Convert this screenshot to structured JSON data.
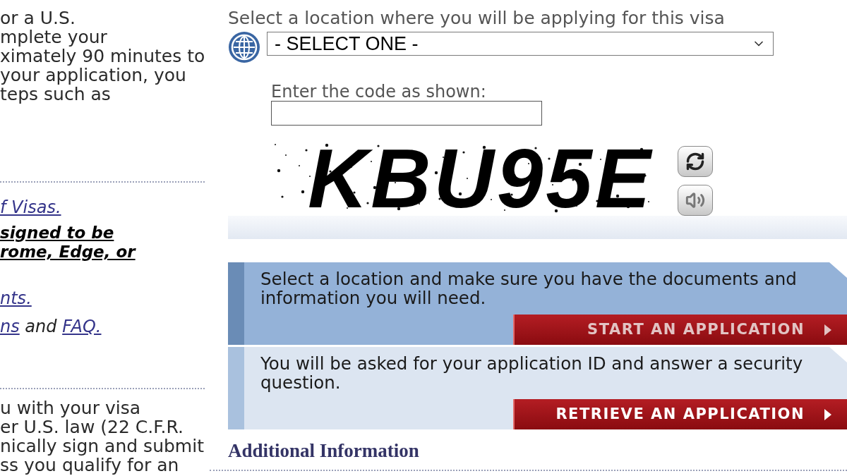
{
  "intro": {
    "lines": [
      "or a U.S.",
      "mplete your",
      "ximately 90 minutes to",
      "your application, you",
      "teps such as"
    ]
  },
  "notes": [
    {
      "kind": "link",
      "lines": [
        "f Visas."
      ]
    },
    {
      "kind": "warning",
      "lines": [
        "signed to be",
        "rome, Edge, or"
      ]
    },
    {
      "kind": "link",
      "lines": [
        "nts."
      ]
    },
    {
      "kind": "mixed",
      "parts": [
        {
          "kind": "link",
          "text": "ns"
        },
        {
          "kind": "plain",
          "text": "and"
        },
        {
          "kind": "link",
          "text": "FAQ."
        }
      ]
    }
  ],
  "disclaimer": {
    "lines": [
      "u with your visa",
      "er U.S. law (22 C.F.R.",
      "nically sign and submit",
      "ss you qualify for an"
    ]
  },
  "location": {
    "label": "Select a location where you will be applying for this visa",
    "select": {
      "value": "- SELECT ONE -"
    }
  },
  "captcha": {
    "label": "Enter the code as shown:",
    "code": "KBU95E"
  },
  "actions": [
    {
      "kind": "dark",
      "text": "Select a location and make sure you have the documents and information you will need.",
      "button": {
        "label": "START AN APPLICATION",
        "disabled": true
      }
    },
    {
      "kind": "light",
      "text": "You will be asked for your application ID and answer a security question.",
      "button": {
        "label": "RETRIEVE AN APPLICATION",
        "disabled": false
      }
    }
  ],
  "additional": {
    "title": "Additional Information"
  }
}
